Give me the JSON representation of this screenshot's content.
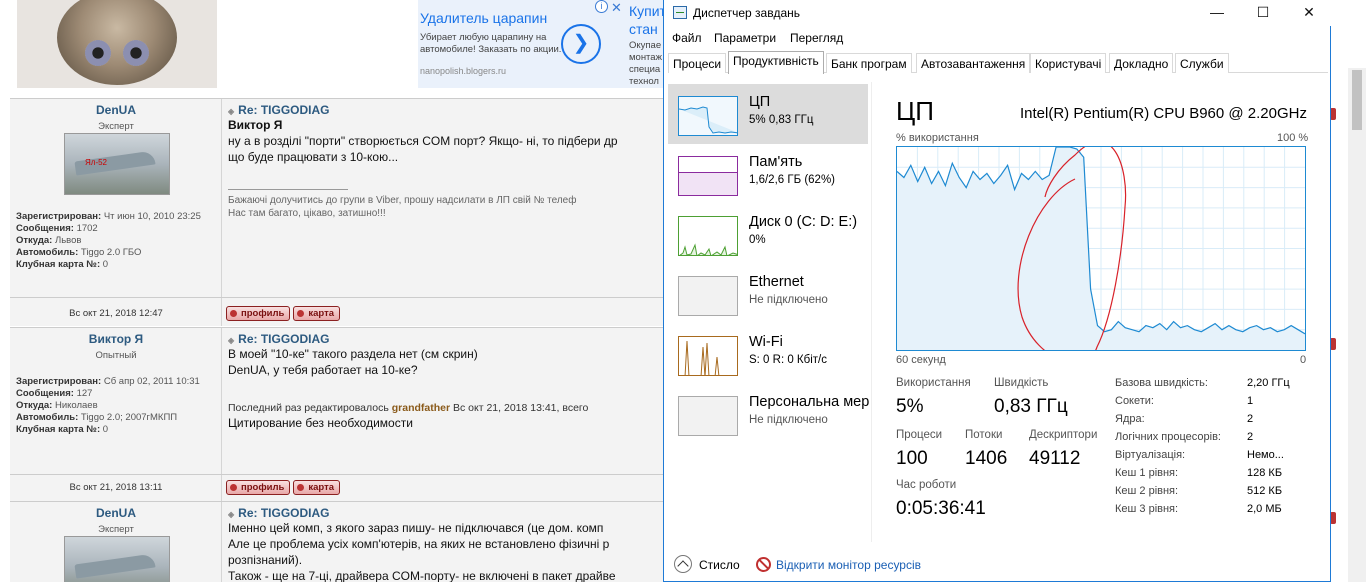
{
  "forum": {
    "ad1": {
      "info": "i"
    },
    "ad2": {
      "title": "Удалитель царапин",
      "desc": "Убирает любую царапину на автомобиле! Заказать по акции.",
      "url": "nanopolish.blogers.ru",
      "arrow": "❯",
      "info": "i",
      "close": "✕"
    },
    "ad3": {
      "title": "Купит стан",
      "desc": "Окупае монтаж специа технол ситуац"
    },
    "posts": [
      {
        "user": "DenUA",
        "rank": "Эксперт",
        "profile": [
          {
            "k": "Зарегистрирован:",
            "v": "Чт июн 10, 2010 23:25"
          },
          {
            "k": "Сообщения:",
            "v": "1702"
          },
          {
            "k": "Откуда:",
            "v": "Львов"
          },
          {
            "k": "Автомобиль:",
            "v": "Tiggo 2.0 ГБО"
          },
          {
            "k": "Клубная карта №:",
            "v": "0"
          }
        ],
        "title": "Re: TIGGODIAG",
        "lines": [
          "Виктор Я",
          "ну а в розділі \"порти\" створюється COM порт? Якщо- ні, то підбери др",
          "що буде працювати з 10-кою..."
        ],
        "sig": [
          "Бажаючі долучитись до групи в Viber, прошу надсилати в ЛП свій № телеф",
          "Нас там багато, цікаво, затишно!!!"
        ],
        "date": "Вс окт 21, 2018 12:47"
      },
      {
        "user": "Виктор Я",
        "rank": "Опытный",
        "profile": [
          {
            "k": "Зарегистрирован:",
            "v": "Сб апр 02, 2011 10:31"
          },
          {
            "k": "Сообщения:",
            "v": "127"
          },
          {
            "k": "Откуда:",
            "v": "Николаев"
          },
          {
            "k": "Автомобиль:",
            "v": "Tiggo 2.0; 2007гМКПП"
          },
          {
            "k": "Клубная карта №:",
            "v": "0"
          }
        ],
        "title": "Re: TIGGODIAG",
        "lines": [
          "В моей \"10-ке\" такого раздела нет (см скрин)",
          "DenUA, у тебя работает на 10-ке?"
        ],
        "edit_prefix": "Последний раз редактировалось ",
        "edit_user": "grandfather",
        "edit_suffix": " Вс окт 21, 2018 13:41, всего",
        "edit_reason": "Цитирование без необходимости",
        "date": "Вс окт 21, 2018 13:11"
      },
      {
        "user": "DenUA",
        "rank": "Эксперт",
        "title": "Re: TIGGODIAG",
        "lines": [
          "Іменно цей комп, з якого зараз пишу- не підключався (це дом. комп",
          "Але це проблема усіх комп'ютерів, на яких не встановлено фізичні р",
          "розпізнаний).",
          "Також - ще на 7-ці, драйвера COM-порту- не включені в пакет драйве"
        ]
      }
    ],
    "buttons": {
      "profile": "профиль",
      "map": "карта"
    }
  },
  "taskmgr": {
    "title": "Диспетчер завдань",
    "window_buttons": {
      "minimize": "—",
      "maximize": "☐",
      "close": "✕"
    },
    "menu": [
      "Файл",
      "Параметри",
      "Перегляд"
    ],
    "tabs": [
      "Процеси",
      "Продуктивність",
      "Банк програм",
      "Автозавантаження",
      "Користувачі",
      "Докладно",
      "Служби"
    ],
    "active_tab": "Продуктивність",
    "resources": [
      {
        "name": "ЦП",
        "sub": "5% 0,83 ГГц",
        "color": "#1e8ad2",
        "selected": true
      },
      {
        "name": "Пам'ять",
        "sub": "1,6/2,6 ГБ (62%)",
        "color": "#8b2b9e",
        "selected": false
      },
      {
        "name": "Диск 0 (C: D: E:)",
        "sub": "0%",
        "color": "#4da033",
        "selected": false
      },
      {
        "name": "Ethernet",
        "sub": "Не підключено",
        "color": "#a0a0a0",
        "selected": false
      },
      {
        "name": "Wi-Fi",
        "sub": "S: 0  R: 0 Кбіт/с",
        "color": "#a86a1e",
        "selected": false
      },
      {
        "name": "Персональна мер",
        "sub": "Не підключено",
        "color": "#a0a0a0",
        "selected": false
      }
    ],
    "detail": {
      "title": "ЦП",
      "cpu_model": "Intel(R) Pentium(R) CPU B960 @ 2.20GHz",
      "util_label": "% використання",
      "max_label": "100 %",
      "time_left": "60 секунд",
      "time_right": "0",
      "usage_label": "Використання",
      "usage_value": "5%",
      "speed_label": "Швидкість",
      "speed_value": "0,83 ГГц",
      "processes_label": "Процеси",
      "processes_value": "100",
      "threads_label": "Потоки",
      "threads_value": "1406",
      "handles_label": "Дескриптори",
      "handles_value": "49112",
      "uptime_label": "Час роботи",
      "uptime_value": "0:05:36:41",
      "specs": [
        {
          "k": "Базова швидкість:",
          "v": "2,20 ГГц"
        },
        {
          "k": "Сокети:",
          "v": "1"
        },
        {
          "k": "Ядра:",
          "v": "2"
        },
        {
          "k": "Логічних процесорів:",
          "v": "2"
        },
        {
          "k": "Віртуалізація:",
          "v": "Немо..."
        },
        {
          "k": "Кеш 1 рівня:",
          "v": "128 КБ"
        },
        {
          "k": "Кеш 2 рівня:",
          "v": "512 КБ"
        },
        {
          "k": "Кеш 3 рівня:",
          "v": "2,0 МБ"
        }
      ],
      "graph_series": [
        88,
        85,
        91,
        83,
        90,
        82,
        88,
        81,
        92,
        85,
        80,
        88,
        84,
        87,
        82,
        86,
        91,
        79,
        87,
        84,
        88,
        84,
        86,
        100,
        100,
        100,
        99,
        95,
        30,
        12,
        9,
        10,
        14,
        11,
        10,
        9,
        12,
        11,
        13,
        10,
        14,
        11,
        12,
        10,
        9,
        11,
        13,
        10,
        12,
        10,
        9,
        11,
        12,
        10,
        11,
        9,
        10,
        12,
        10,
        8
      ]
    },
    "bottom": {
      "less": "Стисло",
      "monitor": "Відкрити монітор ресурсів"
    }
  }
}
